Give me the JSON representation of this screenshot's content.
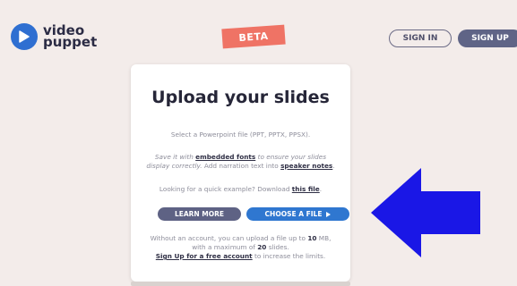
{
  "header": {
    "logo_line1": "video",
    "logo_line2": "puppet",
    "beta_label": "BETA",
    "signin_label": "SIGN IN",
    "signup_label": "SIGN UP"
  },
  "upload": {
    "title": "Upload your slides",
    "select_text": "Select a Powerpoint file (PPT, PPTX, PPSX).",
    "save_prefix": "Save it with ",
    "embedded_fonts_link": "embedded fonts",
    "save_middle": " to ensure your slides",
    "save_line2_prefix": "display correctly.",
    "save_line2_mid": " Add narration text into ",
    "speaker_notes_link": "speaker notes",
    "save_suffix": ".",
    "example_prefix": "Looking for a quick example? Download ",
    "this_file_link": "this file",
    "example_suffix": ".",
    "learn_more_label": "LEARN MORE",
    "choose_file_label": "CHOOSE A FILE",
    "limit_prefix": "Without an account, you can upload a file up to ",
    "limit_size": "10",
    "limit_size_unit": " MB,",
    "limit_line2_prefix": "with a maximum of ",
    "limit_slides": "20",
    "limit_line2_suffix": " slides.",
    "signup_link": "Sign Up for a free account",
    "limit_line3_suffix": " to increase the limits."
  },
  "colors": {
    "background": "#f3ecea",
    "brand_blue": "#2f77d0",
    "beta_red": "#ef7365",
    "secondary_button": "#5e6284",
    "annotation_arrow": "#1a17e6"
  },
  "icons": {
    "logo": "play-circle-icon",
    "choose_file": "play-triangle-icon",
    "annotation": "left-arrow-icon"
  }
}
